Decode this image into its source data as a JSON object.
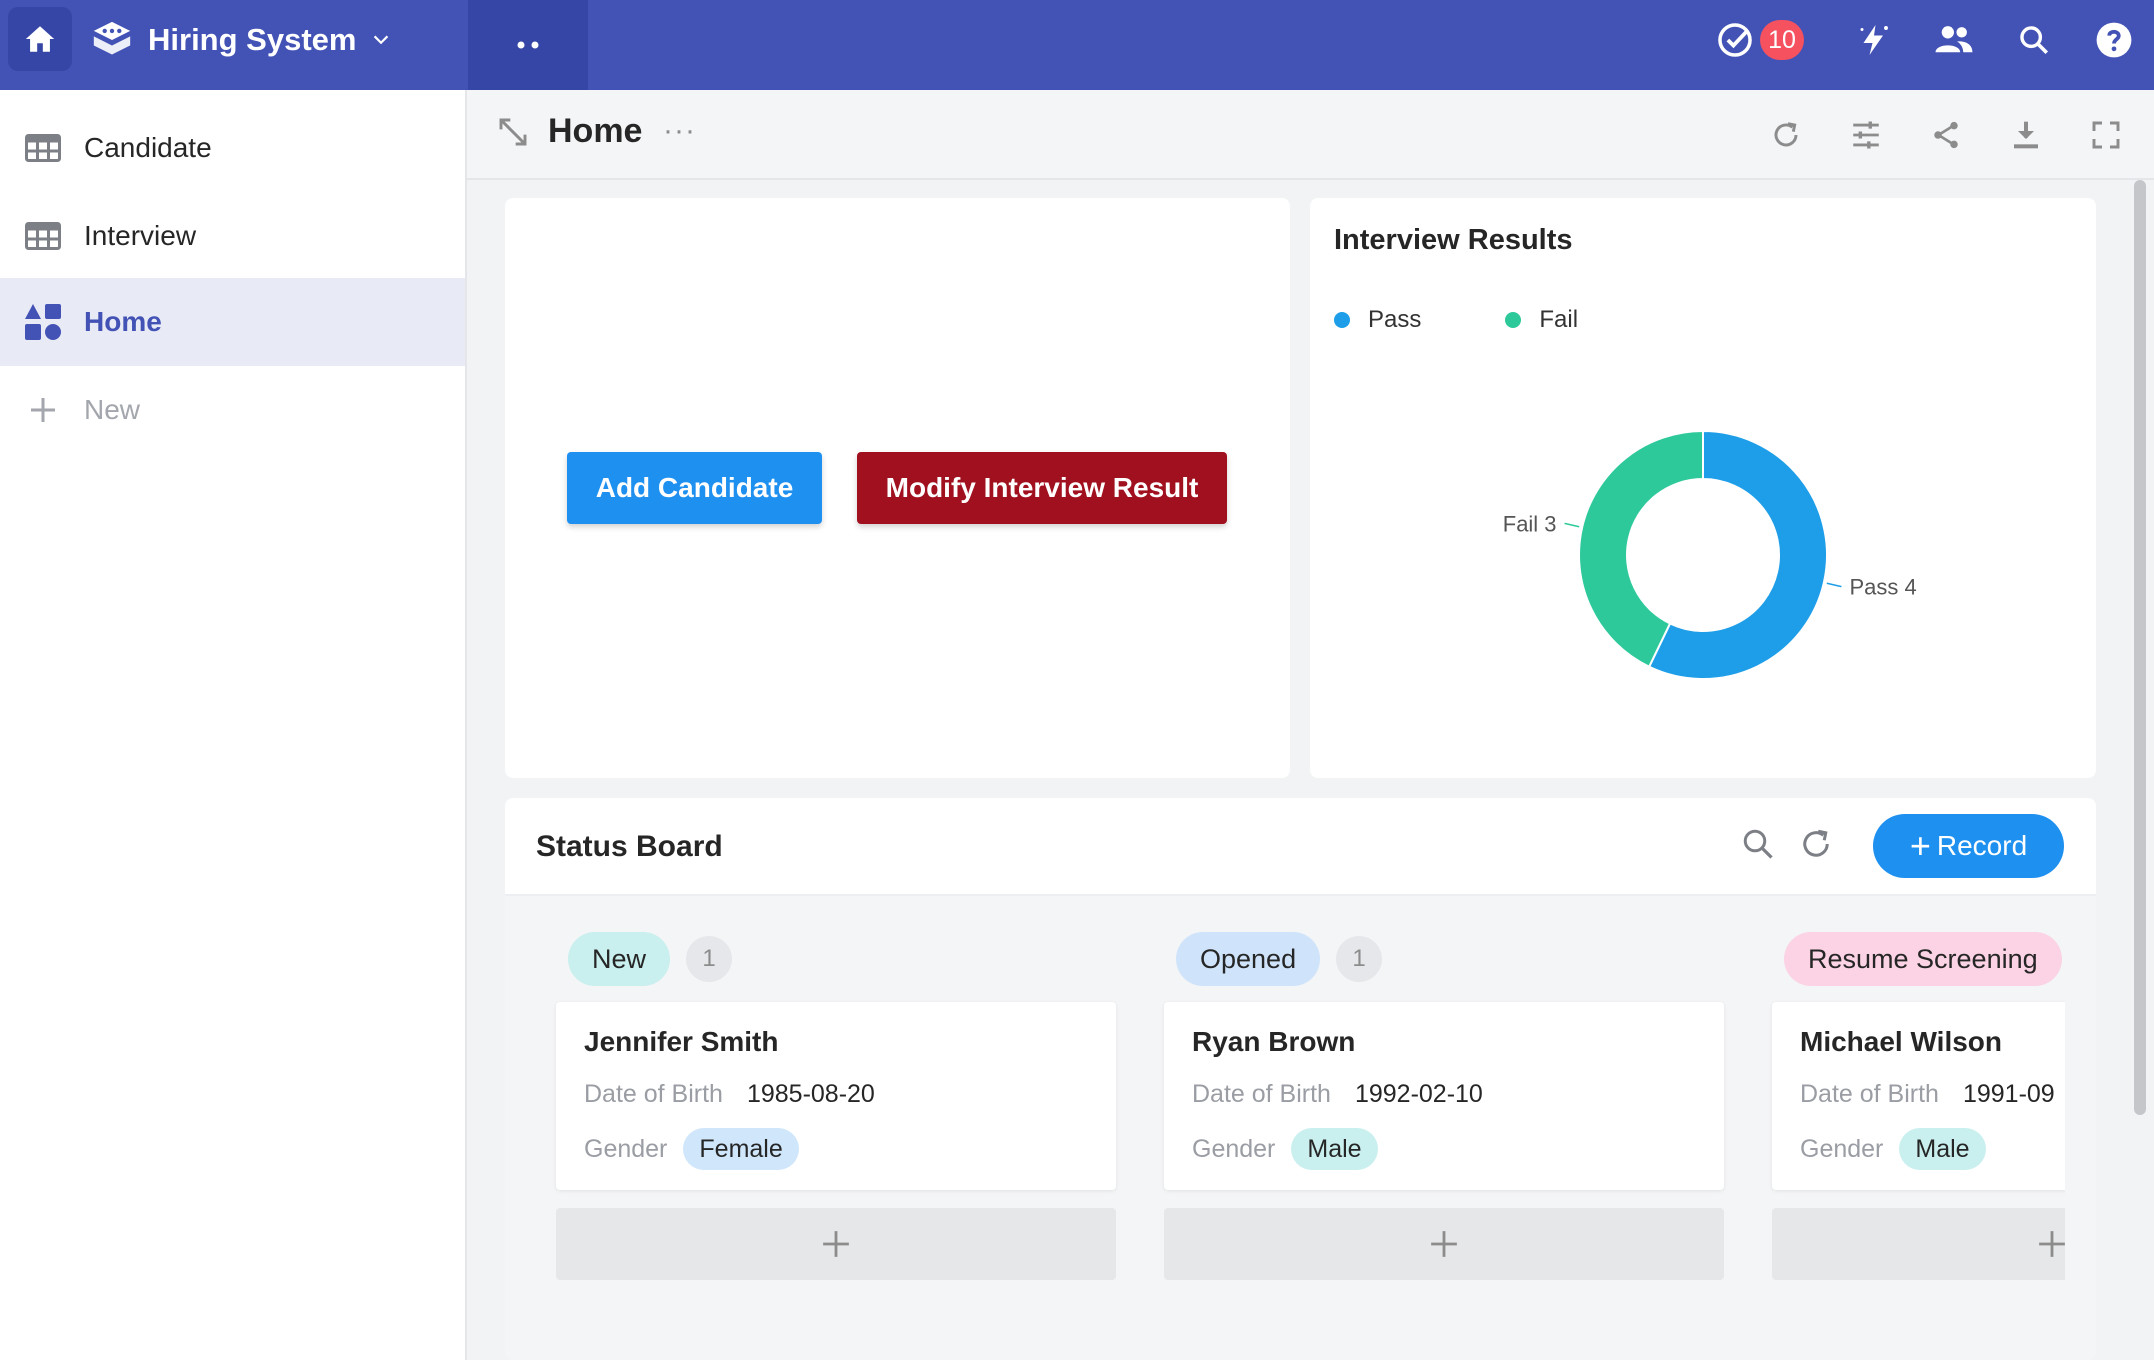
{
  "topbar": {
    "app_title": "Hiring System",
    "tasks_badge": "10",
    "icons": [
      "home-icon",
      "app-logo-icon",
      "chevron-down-icon",
      "more-dots-icon",
      "tasks-check-icon",
      "automation-bolt-icon",
      "members-icon",
      "search-icon",
      "help-icon"
    ]
  },
  "sidebar": {
    "items": [
      {
        "label": "Candidate",
        "icon": "table-icon"
      },
      {
        "label": "Interview",
        "icon": "table-icon"
      },
      {
        "label": "Home",
        "icon": "dashboard-icon",
        "active": true
      },
      {
        "label": "New",
        "icon": "plus-icon"
      }
    ]
  },
  "header": {
    "title": "Home",
    "more": "···",
    "tools": [
      "refresh-icon",
      "filter-settings-icon",
      "share-icon",
      "download-icon",
      "fullscreen-icon"
    ]
  },
  "buttons_card": {
    "add_candidate": "Add Candidate",
    "modify_interview_result": "Modify Interview Result",
    "colors": {
      "add": "#1e90f0",
      "modify": "#a0101e"
    }
  },
  "chart_card": {
    "title": "Interview Results",
    "legend": [
      {
        "label": "Pass",
        "color": "#1e9ee8"
      },
      {
        "label": "Fail",
        "color": "#2ec99a"
      }
    ]
  },
  "chart_data": {
    "type": "pie",
    "title": "Interview Results",
    "donut": true,
    "legend_position": "top-left",
    "categories": [
      "Pass",
      "Fail"
    ],
    "values": [
      4,
      3
    ],
    "labels": [
      {
        "name": "Fail",
        "value": "3"
      },
      {
        "name": "Pass",
        "value": "4"
      }
    ],
    "colors": [
      "#1e9ee8",
      "#2ec99a"
    ]
  },
  "status_board": {
    "title": "Status Board",
    "record_button": "Record",
    "record_plus": "+",
    "columns": [
      {
        "status": "New",
        "count": "1",
        "tag_color": "#c9f0ee",
        "card": {
          "name": "Jennifer Smith",
          "dob_label": "Date of Birth",
          "dob": "1985-08-20",
          "gender_label": "Gender",
          "gender": "Female",
          "gender_color": "#cfe6fb"
        }
      },
      {
        "status": "Opened",
        "count": "1",
        "tag_color": "#cfe4fa",
        "card": {
          "name": "Ryan Brown",
          "dob_label": "Date of Birth",
          "dob": "1992-02-10",
          "gender_label": "Gender",
          "gender": "Male",
          "gender_color": "#c9f0ee"
        }
      },
      {
        "status": "Resume Screening",
        "count": "",
        "tag_color": "#fbd3e4",
        "card": {
          "name": "Michael Wilson",
          "dob_label": "Date of Birth",
          "dob": "1991-09",
          "gender_label": "Gender",
          "gender": "Male",
          "gender_color": "#c9f0ee"
        }
      }
    ]
  }
}
